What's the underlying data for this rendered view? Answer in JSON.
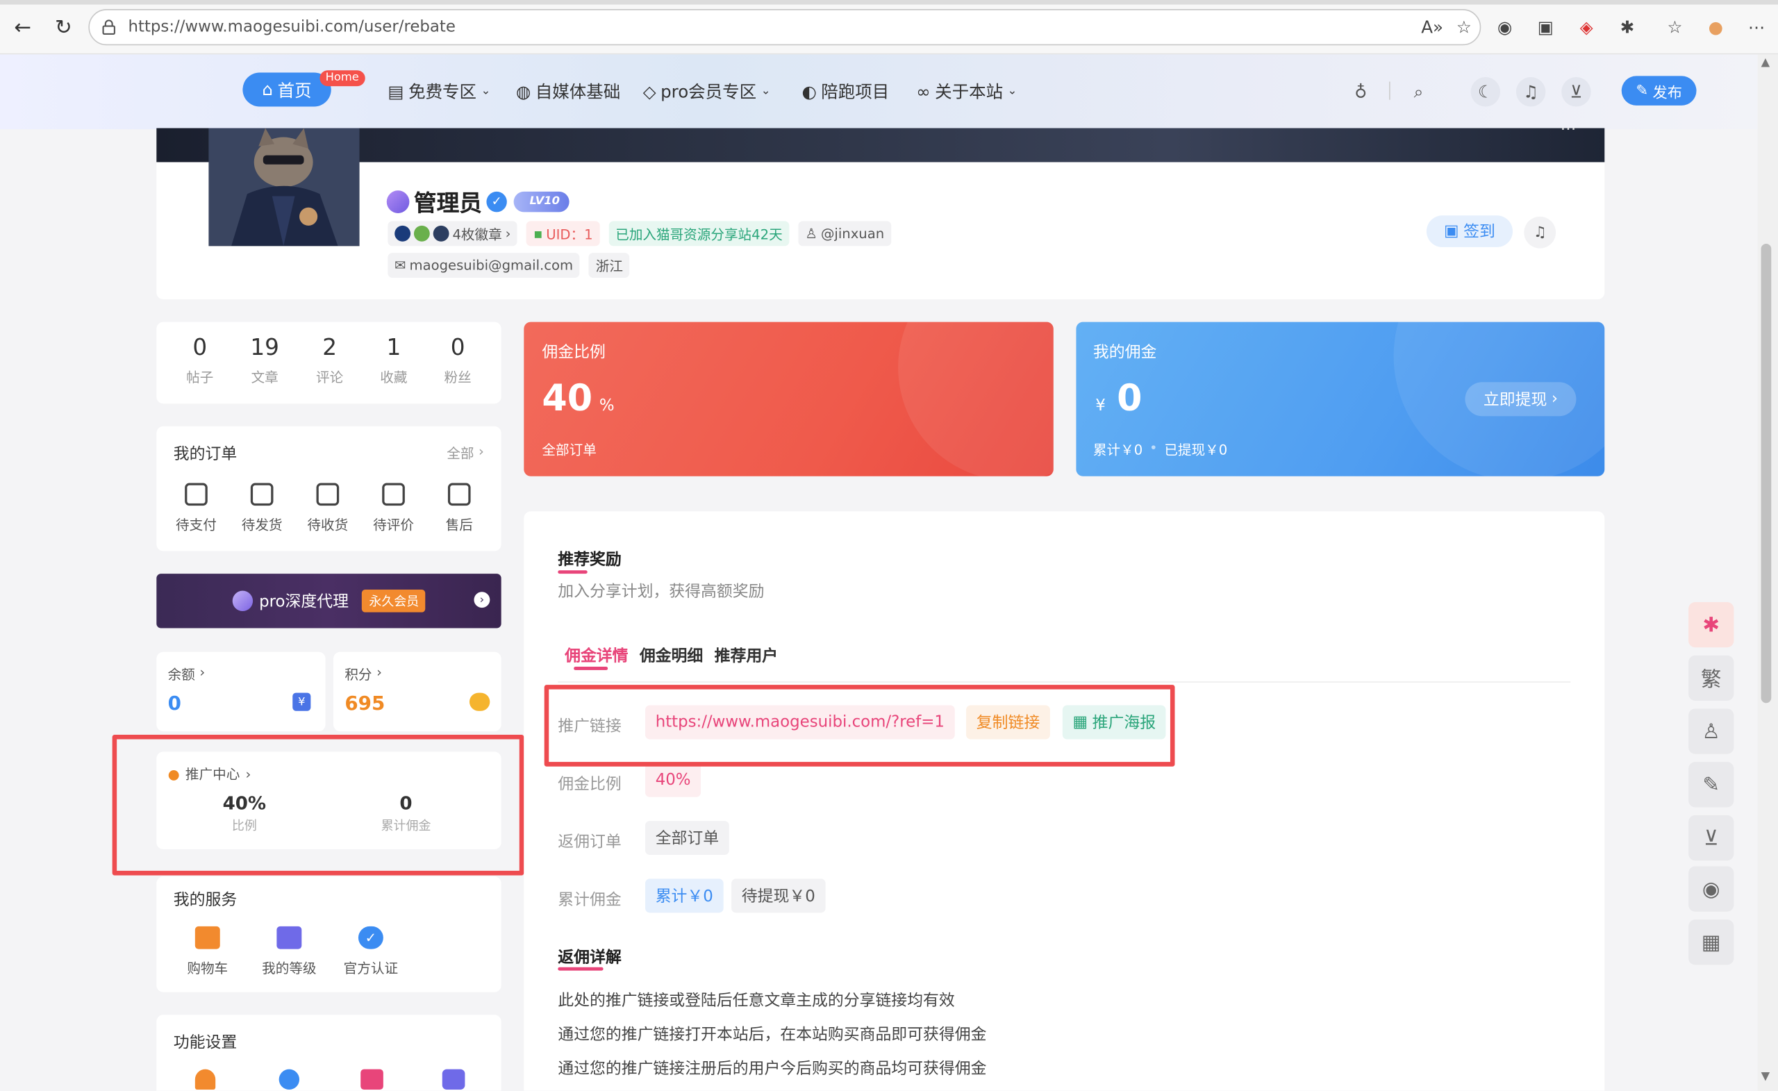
{
  "browser": {
    "url": "https://www.maogesuibi.com/user/rebate",
    "url_host": "www.maogesuibi.com",
    "url_path": "/user/rebate"
  },
  "header": {
    "home_label": "首页",
    "home_badge": "Home",
    "menu": [
      "免费专区",
      "自媒体基础",
      "pro会员专区",
      "陪跑项目",
      "关于本站"
    ],
    "publish_label": "发布"
  },
  "profile": {
    "name": "管理员",
    "level": "LV10",
    "badges": "4枚徽章",
    "uid": "UID：1",
    "joined": "已加入猫哥资源分享站42天",
    "handle": "@jinxuan",
    "email": "maogesuibi@gmail.com",
    "region": "浙江",
    "signin_label": "签到"
  },
  "stats": [
    {
      "num": "0",
      "label": "帖子"
    },
    {
      "num": "19",
      "label": "文章"
    },
    {
      "num": "2",
      "label": "评论"
    },
    {
      "num": "1",
      "label": "收藏"
    },
    {
      "num": "0",
      "label": "粉丝"
    }
  ],
  "orders": {
    "title": "我的订单",
    "all_label": "全部",
    "items": [
      "待支付",
      "待发货",
      "待收货",
      "待评价",
      "售后"
    ]
  },
  "pro_banner": {
    "label": "pro深度代理",
    "badge": "永久会员"
  },
  "balance": {
    "label": "余额",
    "value": "0"
  },
  "points": {
    "label": "积分",
    "value": "695"
  },
  "promo_center": {
    "title": "推广中心",
    "rate": "40%",
    "rate_label": "比例",
    "total": "0",
    "total_label": "累计佣金"
  },
  "services": {
    "title": "我的服务",
    "items": [
      "购物车",
      "我的等级",
      "官方认证"
    ]
  },
  "settings": {
    "title": "功能设置"
  },
  "rate_card": {
    "title": "佣金比例",
    "value": "40",
    "unit": "%",
    "footer": "全部订单"
  },
  "commission_card": {
    "title": "我的佣金",
    "currency": "¥",
    "value": "0",
    "withdraw_label": "立即提现",
    "total_text": "累计￥0",
    "withdrawn_text": "已提现￥0"
  },
  "reward": {
    "title": "推荐奖励",
    "subtitle": "加入分享计划，获得高额奖励",
    "tabs": [
      "佣金详情",
      "佣金明细",
      "推荐用户"
    ],
    "link_label": "推广链接",
    "link_value": "https://www.maogesuibi.com/?ref=1",
    "copy_label": "复制链接",
    "poster_label": "推广海报",
    "rate_label": "佣金比例",
    "rate_value": "40%",
    "orders_label": "返佣订单",
    "orders_value": "全部订单",
    "total_label": "累计佣金",
    "total_value": "累计￥0",
    "pending_value": "待提现￥0",
    "detail_title": "返佣详解",
    "detail_lines": [
      "此处的推广链接或登陆后任意文章主成的分享链接均有效",
      "通过您的推广链接打开本站后，在本站购买商品即可获得佣金",
      "通过您的推广链接注册后的用户今后购买的商品均可获得佣金"
    ]
  },
  "float_bar": {
    "trad_label": "繁"
  },
  "colors": {
    "primary": "#3b8cf2",
    "red": "#ee4b4f",
    "pink": "#e8457a",
    "orange": "#f08a24"
  }
}
